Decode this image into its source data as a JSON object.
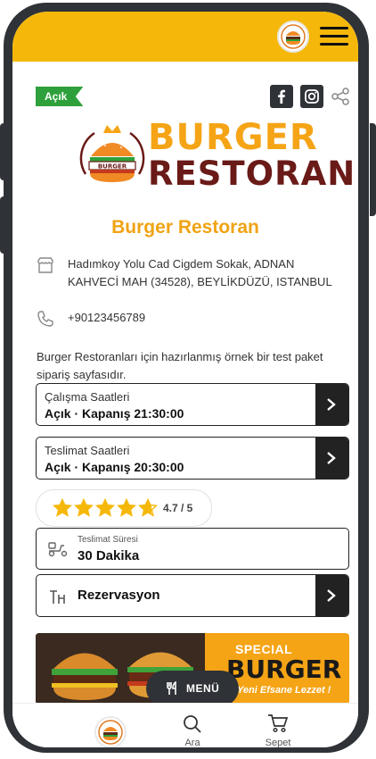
{
  "status_badge": "Açık",
  "brand": {
    "line1": "BURGER",
    "line2": "RESTORAN",
    "emblem_text": "BURGER"
  },
  "restaurant_name": "Burger Restoran",
  "address": "Hadımkoy Yolu Cad Cigdem Sokak, ADNAN KAHVECİ MAH (34528), BEYLİKDÜZÜ, ISTANBUL",
  "phone": "+90123456789",
  "description": "Burger Restoranları için hazırlanmış örnek bir test paket sipariş sayfasıdır.",
  "working_hours": {
    "label": "Çalışma Saatleri",
    "value": "Açık · Kapanış 21:30:00"
  },
  "delivery_hours": {
    "label": "Teslimat Saatleri",
    "value": "Açık · Kapanış 20:30:00"
  },
  "rating": {
    "value": 4.7,
    "display": "4.7 / 5",
    "max": 5
  },
  "delivery_time": {
    "label": "Teslimat Süresi",
    "value": "30 Dakika"
  },
  "reservation": {
    "label": "Rezervasyon"
  },
  "banner": {
    "line1": "SPECIAL",
    "line2": "BURGER",
    "line3": "Yeni Efsane Lezzet !"
  },
  "menu_button": "MENÜ",
  "bottom_nav": {
    "search": "Ara",
    "cart": "Sepet"
  },
  "colors": {
    "accent": "#f5b80a",
    "brand_orange": "#f0a313",
    "brand_dark": "#6a1a17",
    "open_green": "#2ea03b",
    "dark": "#2f3237"
  },
  "icons": [
    "hamburger-menu-icon",
    "facebook-icon",
    "instagram-icon",
    "share-icon",
    "store-icon",
    "phone-icon",
    "chevron-right-icon",
    "star-icon",
    "scooter-icon",
    "reservation-icon",
    "utensils-icon",
    "search-icon",
    "cart-icon"
  ]
}
